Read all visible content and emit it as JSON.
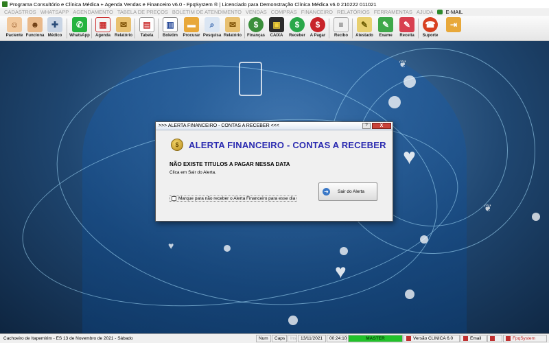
{
  "window": {
    "title": "Programa Consultório e Clínica Médica + Agenda Vendas e Financeiro v6.0 - FpqSystem ® | Licenciado para  Demonstração Clínica Médica v6.0 210222 011021"
  },
  "menu": {
    "items": [
      "CADASTROS",
      "WHATSAPP",
      "AGENDAMENTO",
      "TABELA DE PREÇOS",
      "BOLETIM DE ATENDIMENTO",
      "VENDAS",
      "COMPRAS",
      "FINANCEIRO",
      "RELATÓRIOS",
      "FERRAMENTAS",
      "AJUDA"
    ],
    "email": "E-MAIL"
  },
  "toolbar": {
    "paciente": "Paciente",
    "funciona": "Funciona",
    "medico": "Médico",
    "whatsapp": "WhatsApp",
    "agenda": "Agenda",
    "relatorio1": "Relatório",
    "tabela": "Tabela",
    "boletim": "Boletim",
    "procurar": "Procurar",
    "pesquisa": "Pesquisa",
    "relatorio2": "Relatório",
    "financas": "Finanças",
    "caixa": "CAIXA",
    "receber": "Receber",
    "apagar": "A Pagar",
    "recibo": "Recibo",
    "atestado": "Atestado",
    "exame": "Exame",
    "receita": "Receita",
    "suporte": "Suporte"
  },
  "dialog": {
    "title": ">>> ALERTA FINANCEIRO - CONTAS A RECEBER <<<",
    "help": "?",
    "close": "X",
    "heading": "ALERTA FINANCEIRO - CONTAS A RECEBER",
    "message": "NÃO EXISTE TITULOS A PAGAR NESSA DATA",
    "hint": "Clica em Sair do Alerta.",
    "checkbox_label": "Marque para não receber o Alerta Financeiro para esse dia",
    "exit_button": "Sair do Alerta"
  },
  "statusbar": {
    "location": "Cachoeiro de Itapemirim - ES 13 de Novembro de 2021 - Sábado",
    "num": "Num",
    "caps": "Caps",
    "ins": "Ins",
    "date": "13/11/2021",
    "time": "00:24:10",
    "master": "MASTER",
    "version": "Versão CLINICA 6.0",
    "email": "Email",
    "brand": "FpqSystem"
  }
}
